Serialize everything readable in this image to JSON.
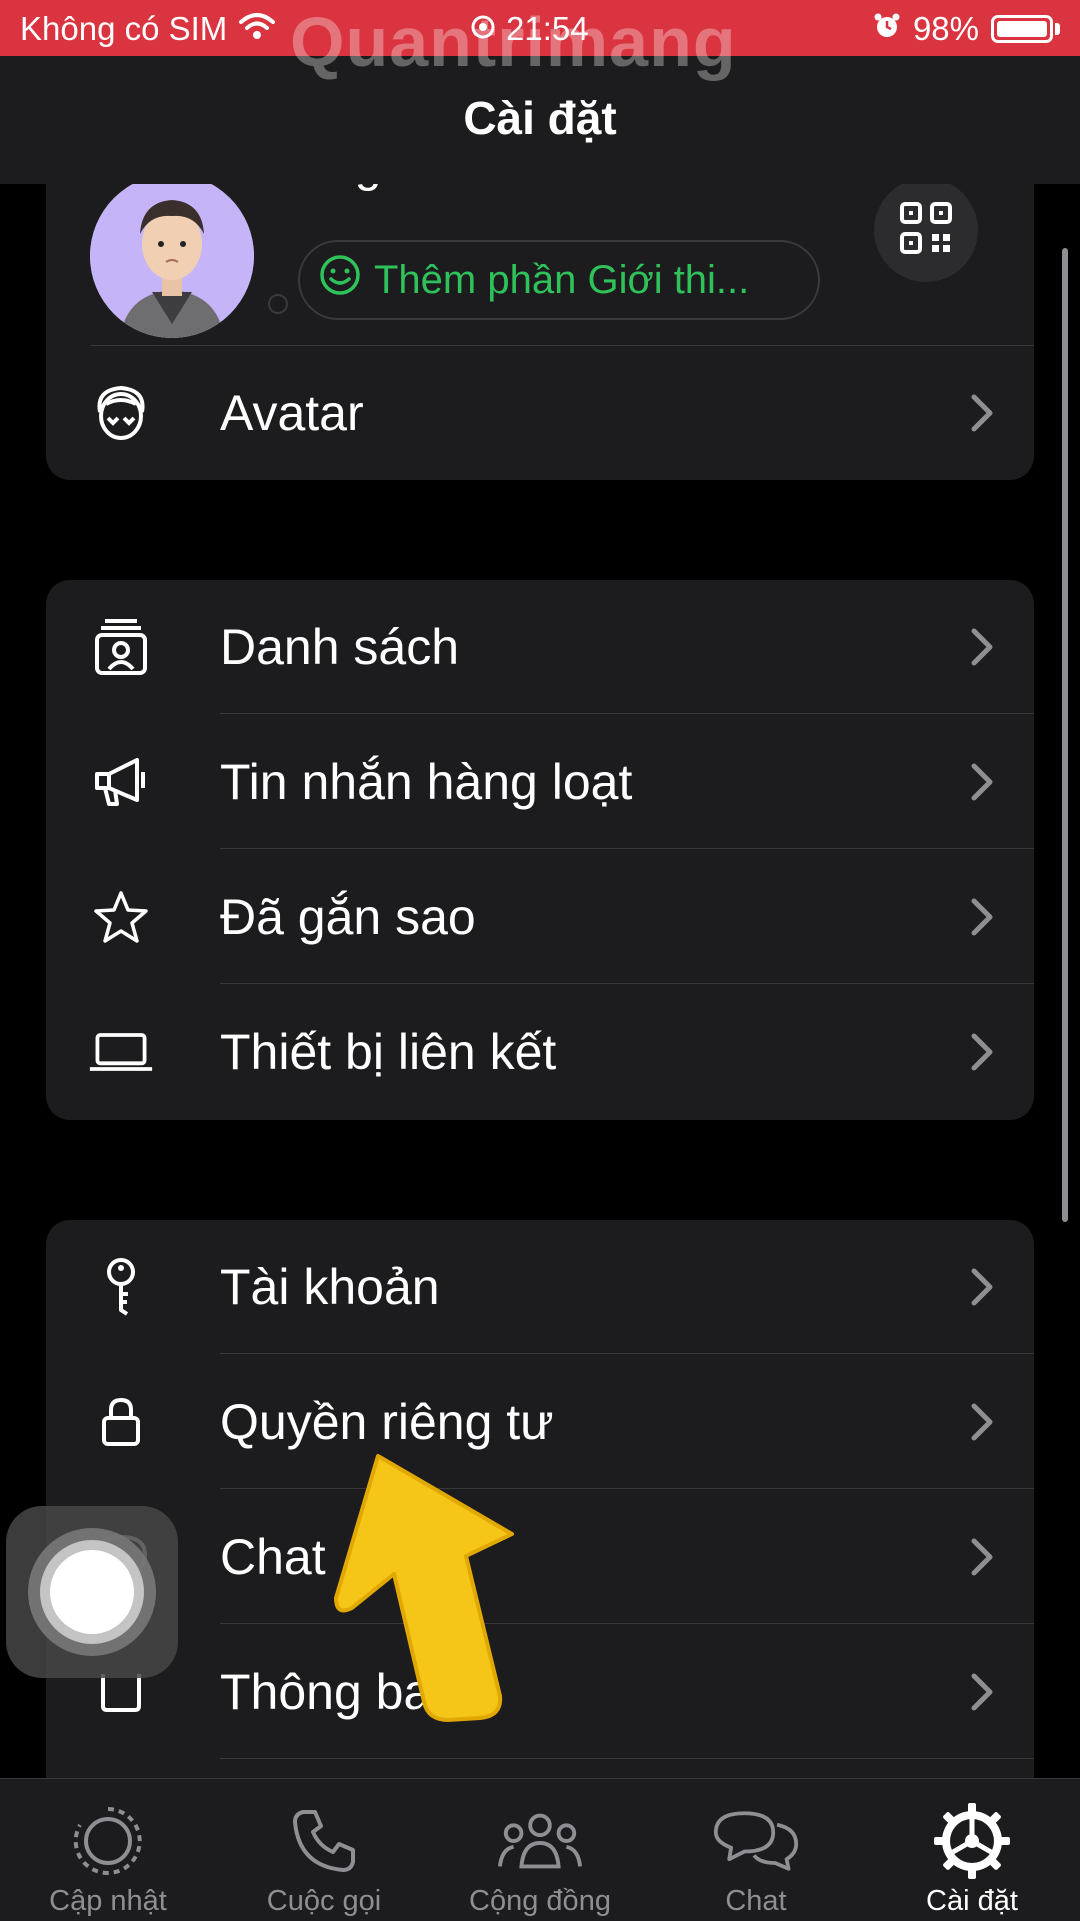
{
  "status_bar": {
    "carrier": "Không có SIM",
    "time": "21:54",
    "battery": "98%"
  },
  "header": {
    "title": "Cài đặt",
    "watermark": "Quantrimang"
  },
  "profile": {
    "name": "Angel Park",
    "about_placeholder": "Thêm phần Giới thi..."
  },
  "sections": [
    {
      "items": [
        {
          "label": "Avatar",
          "icon": "avatar-face-icon"
        }
      ]
    },
    {
      "items": [
        {
          "label": "Danh sách",
          "icon": "contact-list-icon"
        },
        {
          "label": "Tin nhắn hàng loạt",
          "icon": "megaphone-icon"
        },
        {
          "label": "Đã gắn sao",
          "icon": "star-icon"
        },
        {
          "label": "Thiết bị liên kết",
          "icon": "laptop-icon"
        }
      ]
    },
    {
      "items": [
        {
          "label": "Tài khoản",
          "icon": "key-icon"
        },
        {
          "label": "Quyền riêng tư",
          "icon": "lock-icon"
        },
        {
          "label": "Chat",
          "icon": "chat-bubble-icon"
        },
        {
          "label": "Thông ba",
          "icon": "notification-icon"
        }
      ]
    }
  ],
  "tabs": [
    {
      "label": "Cập nhật",
      "icon": "updates-icon",
      "active": false
    },
    {
      "label": "Cuộc gọi",
      "icon": "phone-icon",
      "active": false
    },
    {
      "label": "Cộng đồng",
      "icon": "community-icon",
      "active": false
    },
    {
      "label": "Chat",
      "icon": "chats-icon",
      "active": false
    },
    {
      "label": "Cài đặt",
      "icon": "settings-gear-icon",
      "active": true
    }
  ],
  "colors": {
    "status_bar": "#d9343f",
    "accent_green": "#30c25a",
    "card_bg": "#1c1c1e",
    "arrow": "#f5c518"
  }
}
